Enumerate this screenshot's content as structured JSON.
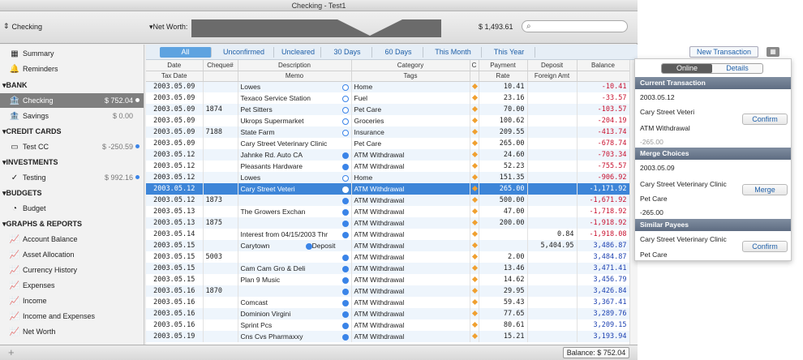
{
  "window": {
    "title": "Checking - Test1"
  },
  "toolbar": {
    "account": "Checking",
    "net_worth_label": "Net Worth:",
    "net_worth_value": "$ 1,493.61",
    "search_placeholder": ""
  },
  "sidebar": {
    "top": [
      {
        "label": "Summary",
        "icon": "summary-icon"
      },
      {
        "label": "Reminders",
        "icon": "bell-icon"
      }
    ],
    "groups": [
      {
        "title": "BANK",
        "items": [
          {
            "label": "Checking",
            "amount": "$ 752.04",
            "selected": true,
            "dot": true
          },
          {
            "label": "Savings",
            "amount": "$ 0.00"
          }
        ]
      },
      {
        "title": "CREDIT CARDS",
        "items": [
          {
            "label": "Test CC",
            "amount": "$ -250.59",
            "dot": true
          }
        ]
      },
      {
        "title": "INVESTMENTS",
        "items": [
          {
            "label": "Testing",
            "amount": "$ 992.16",
            "dot": true
          }
        ]
      },
      {
        "title": "BUDGETS",
        "items": [
          {
            "label": "Budget",
            "amount": ""
          }
        ]
      },
      {
        "title": "GRAPHS & REPORTS",
        "items": [
          {
            "label": "Account Balance"
          },
          {
            "label": "Asset Allocation"
          },
          {
            "label": "Currency History"
          },
          {
            "label": "Expenses"
          },
          {
            "label": "Income"
          },
          {
            "label": "Income and Expenses"
          },
          {
            "label": "Net Worth"
          }
        ]
      }
    ]
  },
  "filters": [
    "All",
    "Unconfirmed",
    "Uncleared",
    "30 Days",
    "60 Days",
    "This Month",
    "This Year"
  ],
  "new_transaction_label": "New Transaction",
  "columns": {
    "row1": [
      "Date",
      "Cheque#",
      "Description",
      "Category",
      "C",
      "Payment",
      "Deposit",
      "Balance"
    ],
    "row2": [
      "Tax Date",
      "",
      "Memo",
      "Tags",
      "",
      "Rate",
      "Foreign Amt",
      ""
    ]
  },
  "transactions": [
    {
      "date": "2003.05.09",
      "cheque": "",
      "desc": "Lowes",
      "cleared": "open",
      "category": "Home",
      "payment": "10.41",
      "deposit": "",
      "balance": "-10.41"
    },
    {
      "date": "2003.05.09",
      "cheque": "",
      "desc": "Texaco Service Station",
      "cleared": "open",
      "category": "Fuel",
      "payment": "23.16",
      "deposit": "",
      "balance": "-33.57"
    },
    {
      "date": "2003.05.09",
      "cheque": "1874",
      "desc": "Pet Sitters",
      "cleared": "open",
      "category": "Pet Care",
      "payment": "70.00",
      "deposit": "",
      "balance": "-103.57"
    },
    {
      "date": "2003.05.09",
      "cheque": "",
      "desc": "Ukrops Supermarket",
      "cleared": "open",
      "category": "Groceries",
      "payment": "100.62",
      "deposit": "",
      "balance": "-204.19"
    },
    {
      "date": "2003.05.09",
      "cheque": "7188",
      "desc": "State Farm",
      "cleared": "open",
      "category": "Insurance",
      "payment": "209.55",
      "deposit": "",
      "balance": "-413.74"
    },
    {
      "date": "2003.05.09",
      "cheque": "",
      "desc": "Cary Street Veterinary Clinic",
      "cleared": "",
      "category": "Pet Care",
      "payment": "265.00",
      "deposit": "",
      "balance": "-678.74"
    },
    {
      "date": "2003.05.12",
      "cheque": "",
      "desc": "Jahnke Rd. Auto CA",
      "cleared": "full",
      "category": "ATM Withdrawal",
      "payment": "24.60",
      "deposit": "",
      "balance": "-703.34"
    },
    {
      "date": "2003.05.12",
      "cheque": "",
      "desc": "Pleasants Hardware",
      "cleared": "full",
      "category": "ATM Withdrawal",
      "payment": "52.23",
      "deposit": "",
      "balance": "-755.57"
    },
    {
      "date": "2003.05.12",
      "cheque": "",
      "desc": "Lowes",
      "cleared": "open",
      "category": "Home",
      "payment": "151.35",
      "deposit": "",
      "balance": "-906.92"
    },
    {
      "date": "2003.05.12",
      "cheque": "",
      "desc": "Cary Street Veteri",
      "cleared": "open",
      "category": "ATM Withdrawal",
      "payment": "265.00",
      "deposit": "",
      "balance": "-1,171.92",
      "selected": true
    },
    {
      "date": "2003.05.12",
      "cheque": "1873",
      "desc": "",
      "cleared": "full",
      "category": "ATM Withdrawal",
      "payment": "500.00",
      "deposit": "",
      "balance": "-1,671.92"
    },
    {
      "date": "2003.05.13",
      "cheque": "",
      "desc": "The Growers Exchan",
      "cleared": "full",
      "category": "ATM Withdrawal",
      "payment": "47.00",
      "deposit": "",
      "balance": "-1,718.92"
    },
    {
      "date": "2003.05.13",
      "cheque": "1875",
      "desc": "",
      "cleared": "full",
      "category": "ATM Withdrawal",
      "payment": "200.00",
      "deposit": "",
      "balance": "-1,918.92"
    },
    {
      "date": "2003.05.14",
      "cheque": "",
      "desc": "Interest from 04/15/2003 Thr",
      "cleared": "full",
      "category": "ATM Withdrawal",
      "payment": "",
      "deposit": "0.84",
      "balance": "-1,918.08"
    },
    {
      "date": "2003.05.15",
      "cheque": "",
      "desc": "Carytown",
      "desc2": "Deposit",
      "cleared": "full",
      "category": "ATM Withdrawal",
      "payment": "",
      "deposit": "5,404.95",
      "balance": "3,486.87"
    },
    {
      "date": "2003.05.15",
      "cheque": "5003",
      "desc": "",
      "cleared": "full",
      "category": "ATM Withdrawal",
      "payment": "2.00",
      "deposit": "",
      "balance": "3,484.87"
    },
    {
      "date": "2003.05.15",
      "cheque": "",
      "desc": "Cam Cam Gro & Deli",
      "cleared": "full",
      "category": "ATM Withdrawal",
      "payment": "13.46",
      "deposit": "",
      "balance": "3,471.41"
    },
    {
      "date": "2003.05.15",
      "cheque": "",
      "desc": "Plan 9 Music",
      "cleared": "full",
      "category": "ATM Withdrawal",
      "payment": "14.62",
      "deposit": "",
      "balance": "3,456.79"
    },
    {
      "date": "2003.05.16",
      "cheque": "1870",
      "desc": "",
      "cleared": "full",
      "category": "ATM Withdrawal",
      "payment": "29.95",
      "deposit": "",
      "balance": "3,426.84"
    },
    {
      "date": "2003.05.16",
      "cheque": "",
      "desc": "Comcast",
      "cleared": "full",
      "category": "ATM Withdrawal",
      "payment": "59.43",
      "deposit": "",
      "balance": "3,367.41"
    },
    {
      "date": "2003.05.16",
      "cheque": "",
      "desc": "Dominion Virgini",
      "cleared": "full",
      "category": "ATM Withdrawal",
      "payment": "77.65",
      "deposit": "",
      "balance": "3,289.76"
    },
    {
      "date": "2003.05.16",
      "cheque": "",
      "desc": "Sprint Pcs",
      "cleared": "full",
      "category": "ATM Withdrawal",
      "payment": "80.61",
      "deposit": "",
      "balance": "3,209.15"
    },
    {
      "date": "2003.05.19",
      "cheque": "",
      "desc": "Cns Cvs Pharmaxxy",
      "cleared": "full",
      "category": "ATM Withdrawal",
      "payment": "15.21",
      "deposit": "",
      "balance": "3,193.94"
    }
  ],
  "status": {
    "balance": "Balance: $ 752.04"
  },
  "panel": {
    "tabs": [
      "Online",
      "Details"
    ],
    "current_title": "Current Transaction",
    "current": [
      "2003.05.12",
      "Cary Street Veteri",
      "ATM Withdrawal",
      "-265.00"
    ],
    "confirm_label": "Confirm",
    "merge_title": "Merge Choices",
    "merge": [
      "2003.05.09",
      "Cary Street Veterinary Clinic",
      "Pet Care",
      "-265.00"
    ],
    "merge_label": "Merge",
    "similar_title": "Similar Payees",
    "similar": [
      "Cary Street Veterinary Clinic",
      "Pet Care"
    ],
    "confirm2_label": "Confirm"
  },
  "colors": {
    "accent": "#3d85d8",
    "negative": "#c8102e",
    "positive": "#1a3fb0"
  }
}
